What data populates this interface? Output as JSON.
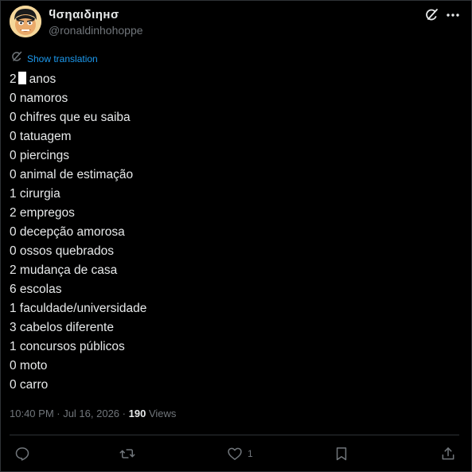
{
  "author": {
    "display_name": "ϥσηαιδιηнσ",
    "handle": "@ronaldinhohoppe"
  },
  "translate_label": "Show translation",
  "post_lines": [
    {
      "prefix": "2",
      "redacted": true,
      "text": "anos"
    },
    {
      "prefix": "",
      "redacted": false,
      "text": "0 namoros"
    },
    {
      "prefix": "",
      "redacted": false,
      "text": "0 chifres que eu saiba"
    },
    {
      "prefix": "",
      "redacted": false,
      "text": "0 tatuagem"
    },
    {
      "prefix": "",
      "redacted": false,
      "text": "0 piercings"
    },
    {
      "prefix": "",
      "redacted": false,
      "text": "0 animal de estimação"
    },
    {
      "prefix": "",
      "redacted": false,
      "text": "1 cirurgia"
    },
    {
      "prefix": "",
      "redacted": false,
      "text": "2 empregos"
    },
    {
      "prefix": "",
      "redacted": false,
      "text": "0 decepção amorosa"
    },
    {
      "prefix": "",
      "redacted": false,
      "text": "0 ossos quebrados"
    },
    {
      "prefix": "",
      "redacted": false,
      "text": "2 mudança de casa"
    },
    {
      "prefix": "",
      "redacted": false,
      "text": "6 escolas"
    },
    {
      "prefix": "",
      "redacted": false,
      "text": "1 faculdade/universidade"
    },
    {
      "prefix": "",
      "redacted": false,
      "text": "3 cabelos diferente"
    },
    {
      "prefix": "",
      "redacted": false,
      "text": "1 concursos públicos"
    },
    {
      "prefix": "",
      "redacted": false,
      "text": "0 moto"
    },
    {
      "prefix": "",
      "redacted": false,
      "text": "0 carro"
    }
  ],
  "meta": {
    "timestamp": "10:40 PM · Jul 16, 2026",
    "separator": "·",
    "views_count": "190",
    "views_label": "Views"
  },
  "actions": {
    "like_count": "1"
  },
  "icons": {
    "header_right": [
      "grok-icon",
      "more-icon"
    ],
    "action_bar": [
      "reply-icon",
      "repost-icon",
      "like-icon",
      "bookmark-icon",
      "share-icon"
    ]
  },
  "colors": {
    "background": "#000000",
    "text": "#e7e9ea",
    "muted": "#71767b",
    "link": "#1d9bf0",
    "divider": "#2f3336"
  }
}
